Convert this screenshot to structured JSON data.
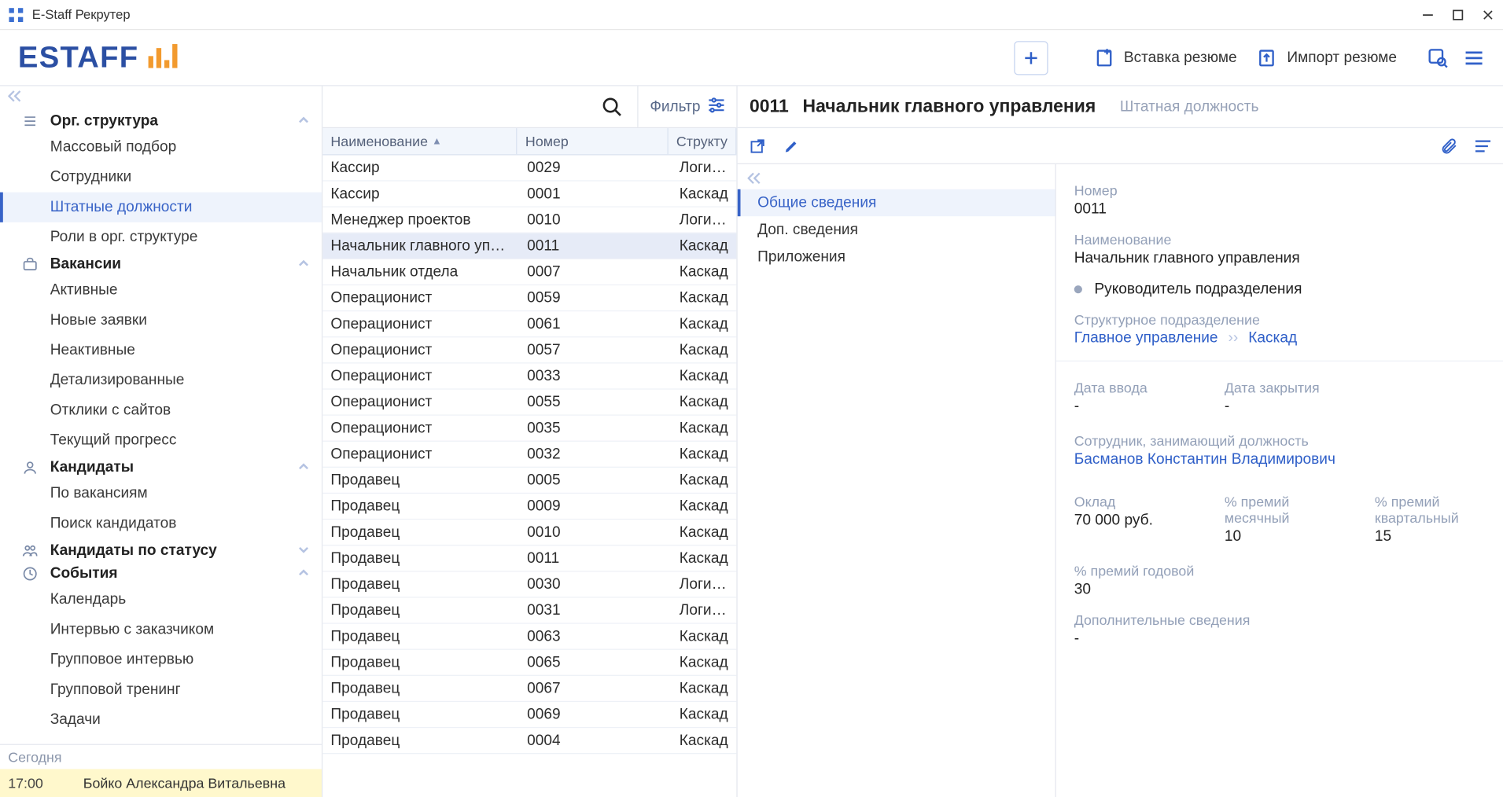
{
  "window": {
    "title": "E-Staff Рекрутер"
  },
  "logo": {
    "text": "ESTAFF"
  },
  "header": {
    "insert_resume": "Вставка резюме",
    "import_resume": "Импорт резюме"
  },
  "sidebar": {
    "groups": [
      {
        "label": "Орг. структура",
        "expanded": true,
        "items": [
          {
            "label": "Массовый подбор",
            "active": false
          },
          {
            "label": "Сотрудники",
            "active": false
          },
          {
            "label": "Штатные должности",
            "active": true
          },
          {
            "label": "Роли в орг. структуре",
            "active": false
          }
        ]
      },
      {
        "label": "Вакансии",
        "expanded": true,
        "items": [
          {
            "label": "Активные"
          },
          {
            "label": "Новые заявки"
          },
          {
            "label": "Неактивные"
          },
          {
            "label": "Детализированные"
          },
          {
            "label": "Отклики с сайтов"
          },
          {
            "label": "Текущий прогресс"
          }
        ]
      },
      {
        "label": "Кандидаты",
        "expanded": true,
        "items": [
          {
            "label": "По вакансиям"
          },
          {
            "label": "Поиск кандидатов"
          }
        ]
      },
      {
        "label": "Кандидаты по статусу",
        "expanded": false,
        "items": []
      },
      {
        "label": "События",
        "expanded": true,
        "items": [
          {
            "label": "Календарь"
          },
          {
            "label": "Интервью с заказчиком"
          },
          {
            "label": "Групповое интервью"
          },
          {
            "label": "Групповой тренинг"
          },
          {
            "label": "Задачи"
          }
        ]
      }
    ],
    "today_label": "Сегодня",
    "today_time": "17:00",
    "today_name": "Бойко Александра Витальевна"
  },
  "list": {
    "filter_label": "Фильтр",
    "columns": {
      "name": "Наименование",
      "number": "Номер",
      "struct": "Структу"
    },
    "rows": [
      {
        "name": "Кассир",
        "num": "0029",
        "struct": "Логисти",
        "selected": false
      },
      {
        "name": "Кассир",
        "num": "0001",
        "struct": "Каскад",
        "selected": false
      },
      {
        "name": "Менеджер проектов",
        "num": "0010",
        "struct": "Логисти",
        "selected": false
      },
      {
        "name": "Начальник главного управле",
        "num": "0011",
        "struct": "Каскад",
        "selected": true
      },
      {
        "name": "Начальник отдела",
        "num": "0007",
        "struct": "Каскад",
        "selected": false
      },
      {
        "name": "Операционист",
        "num": "0059",
        "struct": "Каскад",
        "selected": false
      },
      {
        "name": "Операционист",
        "num": "0061",
        "struct": "Каскад",
        "selected": false
      },
      {
        "name": "Операционист",
        "num": "0057",
        "struct": "Каскад",
        "selected": false
      },
      {
        "name": "Операционист",
        "num": "0033",
        "struct": "Каскад",
        "selected": false
      },
      {
        "name": "Операционист",
        "num": "0055",
        "struct": "Каскад",
        "selected": false
      },
      {
        "name": "Операционист",
        "num": "0035",
        "struct": "Каскад",
        "selected": false
      },
      {
        "name": "Операционист",
        "num": "0032",
        "struct": "Каскад",
        "selected": false
      },
      {
        "name": "Продавец",
        "num": "0005",
        "struct": "Каскад",
        "selected": false
      },
      {
        "name": "Продавец",
        "num": "0009",
        "struct": "Каскад",
        "selected": false
      },
      {
        "name": "Продавец",
        "num": "0010",
        "struct": "Каскад",
        "selected": false
      },
      {
        "name": "Продавец",
        "num": "0011",
        "struct": "Каскад",
        "selected": false
      },
      {
        "name": "Продавец",
        "num": "0030",
        "struct": "Логисти",
        "selected": false
      },
      {
        "name": "Продавец",
        "num": "0031",
        "struct": "Логисти",
        "selected": false
      },
      {
        "name": "Продавец",
        "num": "0063",
        "struct": "Каскад",
        "selected": false
      },
      {
        "name": "Продавец",
        "num": "0065",
        "struct": "Каскад",
        "selected": false
      },
      {
        "name": "Продавец",
        "num": "0067",
        "struct": "Каскад",
        "selected": false
      },
      {
        "name": "Продавец",
        "num": "0069",
        "struct": "Каскад",
        "selected": false
      },
      {
        "name": "Продавец",
        "num": "0004",
        "struct": "Каскад",
        "selected": false
      }
    ]
  },
  "detail": {
    "code": "0011",
    "title": "Начальник главного управления",
    "subtitle": "Штатная должность",
    "tabs": [
      {
        "label": "Общие сведения",
        "active": true
      },
      {
        "label": "Доп. сведения",
        "active": false
      },
      {
        "label": "Приложения",
        "active": false
      }
    ],
    "labels": {
      "number": "Номер",
      "name": "Наименование",
      "head_flag": "Руководитель подразделения",
      "struct_unit": "Структурное подразделение",
      "date_in": "Дата ввода",
      "date_out": "Дата закрытия",
      "employee": "Сотрудник, занимающий должность",
      "salary": "Оклад",
      "bonus_month": "% премий месячный",
      "bonus_quarter": "% премий квартальный",
      "bonus_year": "% премий годовой",
      "extra": "Дополнительные сведения"
    },
    "values": {
      "number": "0011",
      "name": "Начальник главного управления",
      "struct_link1": "Главное управление",
      "struct_link2": "Каскад",
      "date_in": "-",
      "date_out": "-",
      "employee": "Басманов Константин Владимирович",
      "salary": "70 000 руб.",
      "bonus_month": "10",
      "bonus_quarter": "15",
      "bonus_year": "30",
      "extra": "-"
    }
  },
  "icons": {
    "group": [
      "list-icon",
      "briefcase-icon",
      "person-icon",
      "people-group-icon",
      "clock-icon"
    ]
  }
}
